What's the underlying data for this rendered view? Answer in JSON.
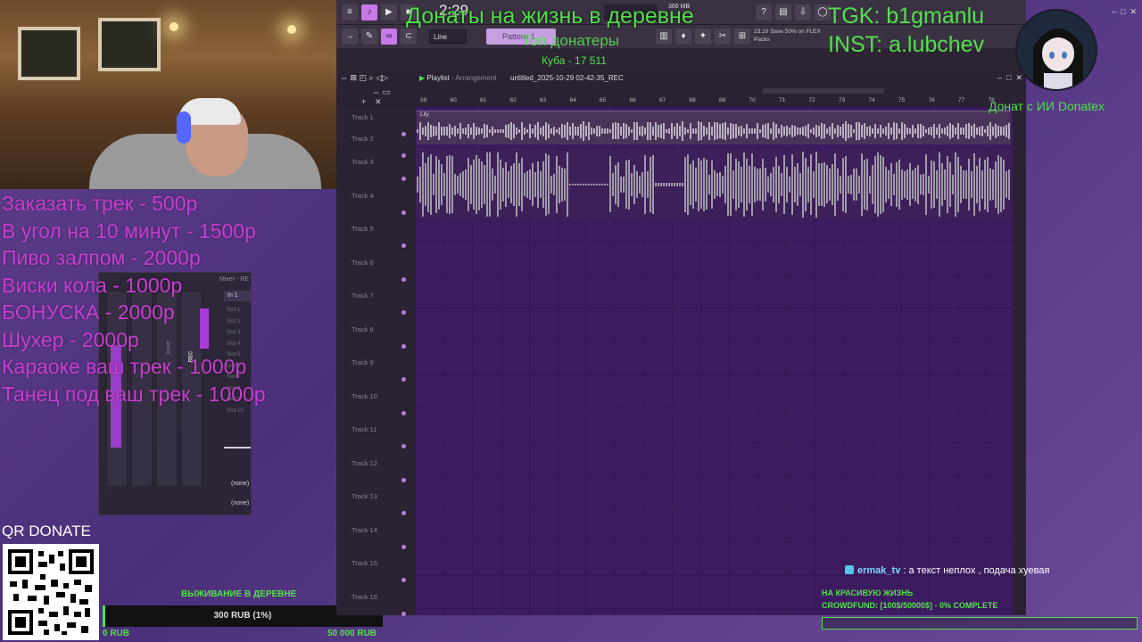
{
  "overlay": {
    "donate_title": "Донаты на жизнь в деревне",
    "top_donors_title": "Топ донатеры",
    "top_donor_entry": "Куба - 17 511",
    "tgk": "TGK: b1gmanlu",
    "inst": "INST: a.lubchev",
    "ai_donate": "Донат с ИИ Donatex",
    "qr_title": "QR DONATE",
    "price_list": [
      "Заказать трек - 500р",
      "В угол на 10 минут - 1500р",
      "Пиво залпом - 2000р",
      "Виски кола - 1000р",
      "БОНУСКА - 2000р",
      "Шухер - 2000р",
      "Караоке ваш трек - 1000р",
      "Танец под ваш трек - 1000р"
    ],
    "crowdfund_left": {
      "title": "ВЫЖИВАНИЕ В ДЕРЕВНЕ",
      "current": "300 RUB (1%)",
      "progress_fraction": 0.01,
      "min": "0 RUB",
      "max": "50 000 RUB"
    },
    "chat": {
      "user": "ermak_tv",
      "separator": " : ",
      "message": "а текст неплох , подача хуевая"
    },
    "goal_right": {
      "title": "НА КРАСИВУЮ ЖИЗНЬ",
      "progress": "CROWDFUND: [100$/50000$] - 0% COMPLETE",
      "progress_fraction": 0.0
    }
  },
  "daw": {
    "time": "2:29",
    "memory": "366 MB",
    "line_mode": "Line",
    "pattern": "Pattern 1",
    "promo_version": "23.10",
    "promo_line1": "Save 50% on FLEX",
    "promo_line2": "Packs",
    "playlist_title": "Playlist",
    "playlist_sep": " - ",
    "playlist_sub": "Arrangement",
    "file_name": "untitled_2025-10-29 02-42-35_REC",
    "clip_name": "Lily",
    "ruler": [
      "59",
      "60",
      "61",
      "62",
      "63",
      "64",
      "65",
      "66",
      "67",
      "68",
      "69",
      "70",
      "71",
      "72",
      "73",
      "74",
      "75",
      "76",
      "77",
      "78"
    ],
    "tracks": [
      "Track 1",
      "Track 2",
      "Track 3",
      "Track 4",
      "Track 5",
      "Track 6",
      "Track 7",
      "Track 8",
      "Track 9",
      "Track 10",
      "Track 11",
      "Track 12",
      "Track 13",
      "Track 14",
      "Track 15",
      "Track 16"
    ]
  },
  "mixer": {
    "title": "Mixer - RE",
    "insert_label": "In 1",
    "slots": [
      "Slot 1",
      "Slot 2",
      "Slot 3",
      "Slot 4",
      "Slot 5",
      "Slot 6",
      "Slot 7",
      "Slot 8",
      "Slot 9",
      "Slot 10"
    ],
    "rec_label": "REC",
    "insert_strip_label": "Insert",
    "out_label_1": "(none)",
    "out_label_2": "(none)"
  },
  "colors": {
    "overlay_green": "#52e04a",
    "price_magenta": "#c83ed0",
    "daw_accent": "#c879e8"
  }
}
